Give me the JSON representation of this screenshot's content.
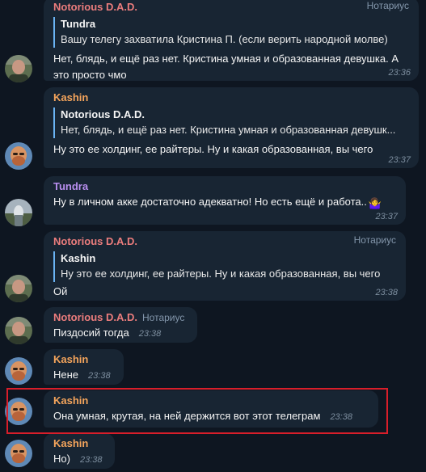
{
  "messages": [
    {
      "sender": "Notorious D.A.D.",
      "role": "Нотариус",
      "reply_name": "Tundra",
      "reply_text": "Вашу телегу захватила Кристина П. (если верить народной молве)",
      "text_lines": [
        "Нет, блядь, и ещё раз нет. Кристина умная и образованная девушка. А",
        "это просто чмо"
      ],
      "time": "23:36"
    },
    {
      "sender": "Kashin",
      "reply_name": "Notorious D.A.D.",
      "reply_text": "Нет, блядь, и ещё раз нет. Кристина умная и образованная девушк...",
      "text": "Ну это ее холдинг, ее райтеры. Ну и какая образованная, вы чего",
      "time": "23:37"
    },
    {
      "sender": "Tundra",
      "text": "Ну в личном акке достаточно адекватно! Но есть ещё и работа..",
      "emoji": "🤷‍♀️",
      "time": "23:37"
    },
    {
      "sender": "Notorious D.A.D.",
      "role": "Нотариус",
      "reply_name": "Kashin",
      "reply_text": "Ну это ее холдинг, ее райтеры. Ну и какая образованная, вы чего",
      "text": "Ой",
      "time": "23:38"
    },
    {
      "sender": "Notorious D.A.D.",
      "role": "Нотариус",
      "text": "Пиздосий тогда",
      "time": "23:38"
    },
    {
      "sender": "Kashin",
      "text": "Нене",
      "time": "23:38"
    },
    {
      "sender": "Kashin",
      "text": "Она умная, крутая, на ней держится вот этот телеграм",
      "time": "23:38"
    },
    {
      "sender": "Kashin",
      "text": "Но)",
      "time": "23:38"
    }
  ]
}
